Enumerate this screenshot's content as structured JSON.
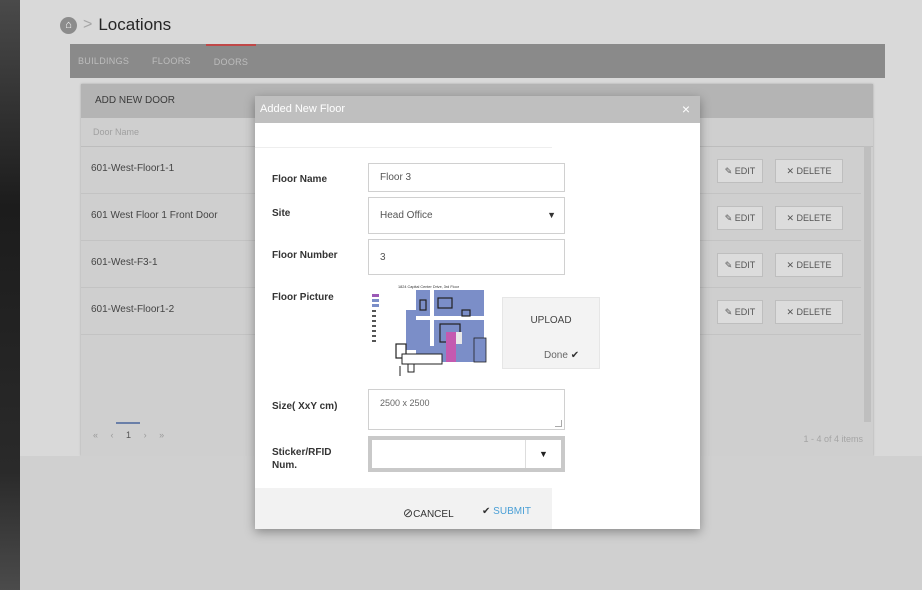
{
  "header": {
    "title": "Locations",
    "separator": ">"
  },
  "tabs": [
    {
      "label": "BUILDINGS"
    },
    {
      "label": "FLOORS"
    },
    {
      "label": "DOORS"
    }
  ],
  "panel": {
    "add_label": "ADD NEW DOOR",
    "column_header": "Door Name",
    "rows": [
      {
        "name": "601-West-Floor1-1"
      },
      {
        "name": "601 West Floor 1 Front Door"
      },
      {
        "name": "601-West-F3-1"
      },
      {
        "name": "601-West-Floor1-2"
      }
    ],
    "edit_label": "EDIT",
    "delete_label": "DELETE",
    "pager": {
      "first": "«",
      "prev": "‹",
      "current": "1",
      "next": "›",
      "last": "»"
    },
    "count_text": "1 - 4 of 4 items"
  },
  "modal": {
    "title": "Added New Floor",
    "close": "×",
    "fields": {
      "floor_name_label": "Floor Name",
      "floor_name_value": "Floor 3",
      "site_label": "Site",
      "site_value": "Head Office",
      "floor_number_label": "Floor Number",
      "floor_number_value": "3",
      "floor_picture_label": "Floor Picture",
      "picture_caption": "1824 Capital Center Drive, 3rd Floor",
      "upload_label": "UPLOAD",
      "done_label": "Done",
      "size_label": "Size( XxY cm)",
      "size_value": "2500 x 2500",
      "sticker_label_1": "Sticker/RFID",
      "sticker_label_2": "Num.",
      "sticker_value": ""
    },
    "cancel_label": "CANCEL",
    "submit_label": "SUBMIT"
  },
  "colors": {
    "accent_tab": "#c04848",
    "submit": "#4a9fd6",
    "floorplan_blue": "#7b8ec8",
    "floorplan_pink": "#c45ab0"
  }
}
